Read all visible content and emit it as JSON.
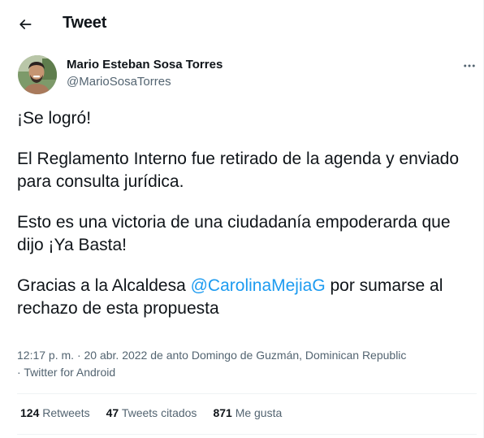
{
  "header": {
    "title": "Tweet"
  },
  "author": {
    "display_name": "Mario Esteban Sosa Torres",
    "handle": "@MarioSosaTorres"
  },
  "tweet": {
    "line1": "¡Se logró!",
    "line2": "El Reglamento Interno fue retirado de la agenda y enviado para consulta jurídica.",
    "line3": "Esto es una victoria de una ciudadanía empoderarda que dijo ¡Ya Basta!",
    "line4_before": "Gracias a la Alcaldesa ",
    "line4_mention": "@CarolinaMejiaG",
    "line4_after": " por sumarse al rechazo de esta propuesta"
  },
  "meta": {
    "time": "12:17 p. m.",
    "date": "20 abr. 2022",
    "location": "de anto Domingo de Guzmán, Dominican Republic",
    "source": "Twitter for Android",
    "separator": "·"
  },
  "stats": {
    "retweets_count": "124",
    "retweets_label": "Retweets",
    "quotes_count": "47",
    "quotes_label": "Tweets citados",
    "likes_count": "871",
    "likes_label": "Me gusta"
  },
  "colors": {
    "text": "#0f1419",
    "secondary": "#536471",
    "accent": "#1d9bf0",
    "divider": "#eff3f4"
  }
}
